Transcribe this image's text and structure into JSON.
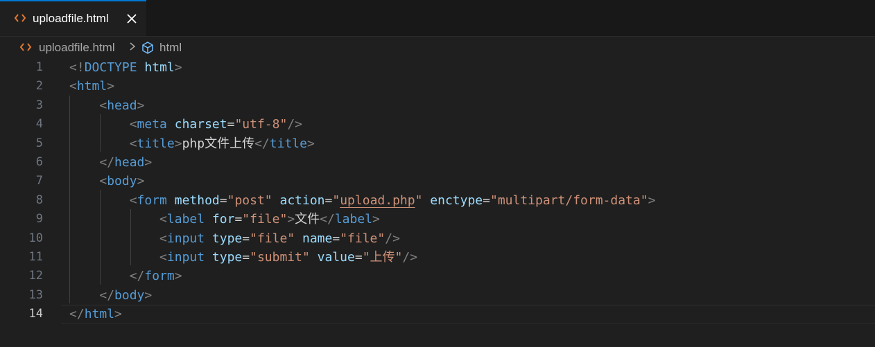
{
  "tab": {
    "label": "uploadfile.html",
    "icon": "html-file-icon",
    "accent": "#0078d4"
  },
  "breadcrumb": {
    "file": "uploadfile.html",
    "symbol": "html"
  },
  "lines": [
    {
      "n": "1",
      "tokens": [
        [
          "p",
          "<!"
        ],
        [
          "k",
          "DOCTYPE"
        ],
        [
          "x",
          " "
        ],
        [
          "a",
          "html"
        ],
        [
          "p",
          ">"
        ]
      ]
    },
    {
      "n": "2",
      "tokens": [
        [
          "p",
          "<"
        ],
        [
          "t",
          "html"
        ],
        [
          "p",
          ">"
        ]
      ]
    },
    {
      "n": "3",
      "tokens": [
        [
          "x",
          "    "
        ],
        [
          "p",
          "<"
        ],
        [
          "t",
          "head"
        ],
        [
          "p",
          ">"
        ]
      ]
    },
    {
      "n": "4",
      "tokens": [
        [
          "x",
          "        "
        ],
        [
          "p",
          "<"
        ],
        [
          "t",
          "meta"
        ],
        [
          "x",
          " "
        ],
        [
          "a",
          "charset"
        ],
        [
          "x",
          "="
        ],
        [
          "s",
          "\"utf-8\""
        ],
        [
          "p",
          "/>"
        ]
      ]
    },
    {
      "n": "5",
      "tokens": [
        [
          "x",
          "        "
        ],
        [
          "p",
          "<"
        ],
        [
          "t",
          "title"
        ],
        [
          "p",
          ">"
        ],
        [
          "x",
          "php文件上传"
        ],
        [
          "p",
          "</"
        ],
        [
          "t",
          "title"
        ],
        [
          "p",
          ">"
        ]
      ]
    },
    {
      "n": "6",
      "tokens": [
        [
          "x",
          "    "
        ],
        [
          "p",
          "</"
        ],
        [
          "t",
          "head"
        ],
        [
          "p",
          ">"
        ]
      ]
    },
    {
      "n": "7",
      "tokens": [
        [
          "x",
          "    "
        ],
        [
          "p",
          "<"
        ],
        [
          "t",
          "body"
        ],
        [
          "p",
          ">"
        ]
      ]
    },
    {
      "n": "8",
      "tokens": [
        [
          "x",
          "        "
        ],
        [
          "p",
          "<"
        ],
        [
          "t",
          "form"
        ],
        [
          "x",
          " "
        ],
        [
          "a",
          "method"
        ],
        [
          "x",
          "="
        ],
        [
          "s",
          "\"post\""
        ],
        [
          "x",
          " "
        ],
        [
          "a",
          "action"
        ],
        [
          "x",
          "="
        ],
        [
          "s",
          "\""
        ],
        [
          "sl",
          "upload.php"
        ],
        [
          "s",
          "\""
        ],
        [
          "x",
          " "
        ],
        [
          "a",
          "enctype"
        ],
        [
          "x",
          "="
        ],
        [
          "s",
          "\"multipart/form-data\""
        ],
        [
          "p",
          ">"
        ]
      ]
    },
    {
      "n": "9",
      "tokens": [
        [
          "x",
          "            "
        ],
        [
          "p",
          "<"
        ],
        [
          "t",
          "label"
        ],
        [
          "x",
          " "
        ],
        [
          "a",
          "for"
        ],
        [
          "x",
          "="
        ],
        [
          "s",
          "\"file\""
        ],
        [
          "p",
          ">"
        ],
        [
          "x",
          "文件"
        ],
        [
          "p",
          "</"
        ],
        [
          "t",
          "label"
        ],
        [
          "p",
          ">"
        ]
      ]
    },
    {
      "n": "10",
      "tokens": [
        [
          "x",
          "            "
        ],
        [
          "p",
          "<"
        ],
        [
          "t",
          "input"
        ],
        [
          "x",
          " "
        ],
        [
          "a",
          "type"
        ],
        [
          "x",
          "="
        ],
        [
          "s",
          "\"file\""
        ],
        [
          "x",
          " "
        ],
        [
          "a",
          "name"
        ],
        [
          "x",
          "="
        ],
        [
          "s",
          "\"file\""
        ],
        [
          "p",
          "/>"
        ]
      ]
    },
    {
      "n": "11",
      "tokens": [
        [
          "x",
          "            "
        ],
        [
          "p",
          "<"
        ],
        [
          "t",
          "input"
        ],
        [
          "x",
          " "
        ],
        [
          "a",
          "type"
        ],
        [
          "x",
          "="
        ],
        [
          "s",
          "\"submit\""
        ],
        [
          "x",
          " "
        ],
        [
          "a",
          "value"
        ],
        [
          "x",
          "="
        ],
        [
          "s",
          "\"上传\""
        ],
        [
          "p",
          "/>"
        ]
      ]
    },
    {
      "n": "12",
      "tokens": [
        [
          "x",
          "        "
        ],
        [
          "p",
          "</"
        ],
        [
          "t",
          "form"
        ],
        [
          "p",
          ">"
        ]
      ]
    },
    {
      "n": "13",
      "tokens": [
        [
          "x",
          "    "
        ],
        [
          "p",
          "</"
        ],
        [
          "t",
          "body"
        ],
        [
          "p",
          ">"
        ]
      ]
    },
    {
      "n": "14",
      "tokens": [
        [
          "p",
          "</"
        ],
        [
          "t",
          "html"
        ],
        [
          "p",
          ">"
        ]
      ]
    }
  ],
  "current_line": "14"
}
